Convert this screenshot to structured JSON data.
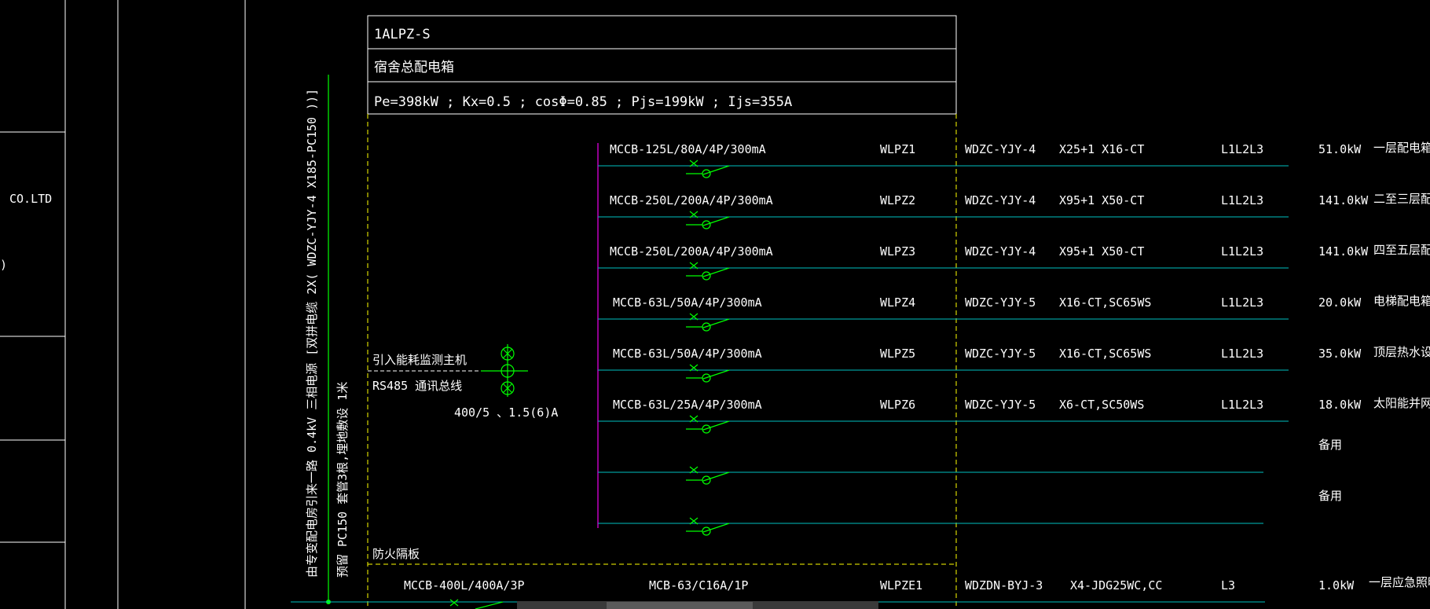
{
  "title_block": {
    "panel_code": "1ALPZ-S",
    "panel_name": "宿舍总配电箱",
    "params": "Pe=398kW  ; Kx=0.5  ; cosΦ=0.85  ; Pjs=199kW  ; Ijs=355A"
  },
  "side_panel": {
    "company": "CO.LTD",
    "bracket": ")"
  },
  "incoming": {
    "line1": "由专变配电房引来一路  0.4kV 三相电源 [双拼电缆 2X( WDZC-YJY-4  X185-PC150 ))]",
    "line2": "预留 PC150 套管3根,埋地敷设  1米"
  },
  "meter": {
    "label": "引入能耗监测主机",
    "comm": "RS485 通讯总线",
    "ct": "400/5   、1.5(6)A"
  },
  "firewall_label": "防火隔板",
  "circuits": [
    {
      "breaker": "MCCB-125L/80A/4P/300mA",
      "circuit": "WLPZ1",
      "cable": "WDZC-YJY-4",
      "spec": "X25+1  X16-CT",
      "phase": "L1L2L3",
      "power": "51.0kW",
      "desc": "一层配电箱"
    },
    {
      "breaker": "MCCB-250L/200A/4P/300mA",
      "circuit": "WLPZ2",
      "cable": "WDZC-YJY-4",
      "spec": "X95+1  X50-CT",
      "phase": "L1L2L3",
      "power": "141.0kW",
      "desc": "二至三层配"
    },
    {
      "breaker": "MCCB-250L/200A/4P/300mA",
      "circuit": "WLPZ3",
      "cable": "WDZC-YJY-4",
      "spec": "X95+1  X50-CT",
      "phase": "L1L2L3",
      "power": "141.0kW",
      "desc": "四至五层配"
    },
    {
      "breaker": "MCCB-63L/50A/4P/300mA",
      "circuit": "WLPZ4",
      "cable": "WDZC-YJY-5",
      "spec": "X16-CT,SC65WS",
      "phase": "L1L2L3",
      "power": "20.0kW",
      "desc": "电梯配电箱"
    },
    {
      "breaker": "MCCB-63L/50A/4P/300mA",
      "circuit": "WLPZ5",
      "cable": "WDZC-YJY-5",
      "spec": "X16-CT,SC65WS",
      "phase": "L1L2L3",
      "power": "35.0kW",
      "desc": "顶层热水设备"
    },
    {
      "breaker": "MCCB-63L/25A/4P/300mA",
      "circuit": "WLPZ6",
      "cable": "WDZC-YJY-5",
      "spec": "X6-CT,SC50WS",
      "phase": "L1L2L3",
      "power": "18.0kW",
      "desc": "太阳能并网专"
    },
    {
      "breaker": "",
      "circuit": "",
      "cable": "",
      "spec": "",
      "phase": "",
      "power": "备用",
      "desc": ""
    },
    {
      "breaker": "",
      "circuit": "",
      "cable": "",
      "spec": "",
      "phase": "",
      "power": "备用",
      "desc": ""
    }
  ],
  "emergency": {
    "main_breaker": "MCCB-400L/400A/3P",
    "breaker": "MCB-63/C16A/1P",
    "circuit": "WLPZE1",
    "cable": "WDZDN-BYJ-3",
    "spec": "X4-JDG25WC,CC",
    "phase": "L3",
    "power": "1.0kW",
    "desc": "一层应急照明配"
  },
  "colors": {
    "background": "#000000",
    "frame": "#ffffff",
    "bus_busbar": "#c000c0",
    "feeder": "#00c0c0",
    "switch": "#00ff00",
    "boundary_dash": "#ffff00",
    "grey_line": "#808080"
  }
}
